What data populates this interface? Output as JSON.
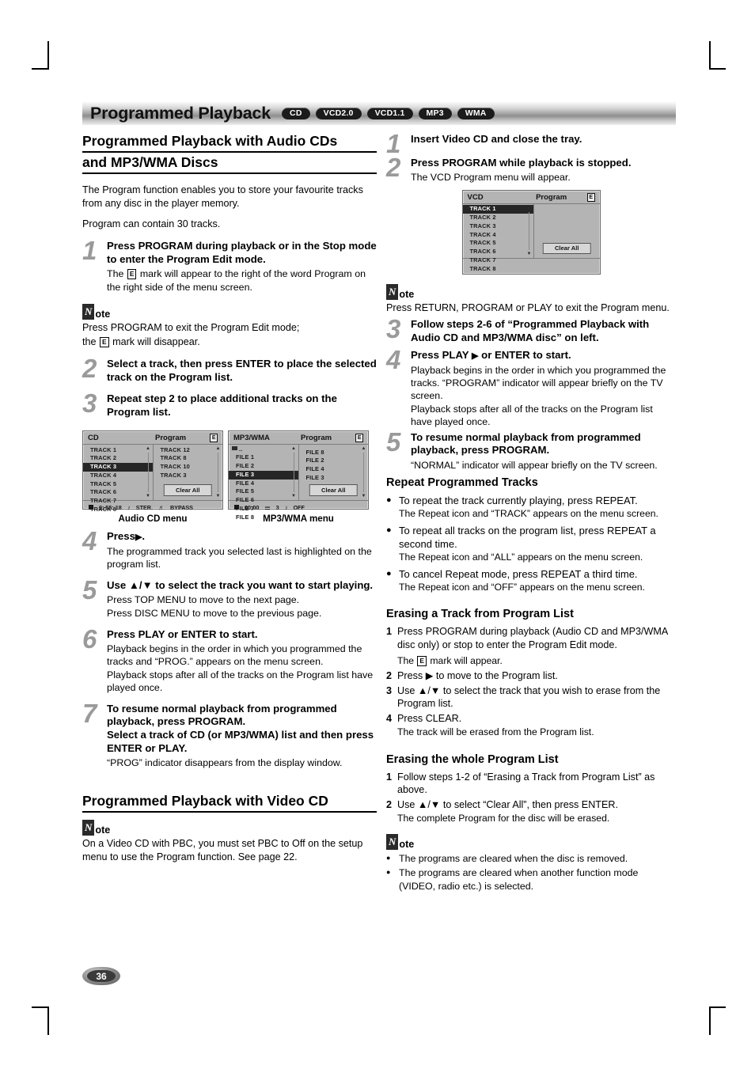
{
  "header": {
    "title": "Programmed Playback",
    "badges": [
      "CD",
      "VCD2.0",
      "VCD1.1",
      "MP3",
      "WMA"
    ]
  },
  "left": {
    "section_title_line1": "Programmed Playback with Audio CDs",
    "section_title_line2": "and MP3/WMA Discs",
    "intro1": "The Program function enables you to store your favourite tracks from any disc in the player memory.",
    "intro2": "Program can contain 30 tracks.",
    "step1": {
      "num": "1",
      "head": "Press PROGRAM during playback or in the Stop mode to enter the Program Edit mode.",
      "sub_a": "The",
      "sub_b": "mark will appear to the right of the word Program on the right side of the menu screen."
    },
    "note1": {
      "badge": "N",
      "word": "ote",
      "line1": "Press PROGRAM to exit the Program Edit mode;",
      "line2_a": "the",
      "line2_b": "mark will disappear."
    },
    "step2": {
      "num": "2",
      "head": "Select a track, then press ENTER to place the selected track on the Program list."
    },
    "step3": {
      "num": "3",
      "head": "Repeat step 2 to place additional tracks on the Program list."
    },
    "cd_screen": {
      "left_title": "CD",
      "right_title": "Program",
      "edit_mark": "E",
      "tracks": [
        "TRACK 1",
        "TRACK 2",
        "TRACK 3",
        "TRACK 4",
        "TRACK 5",
        "TRACK 6",
        "TRACK 7",
        "TRACK 8"
      ],
      "highlight_index": 2,
      "program": [
        "TRACK 12",
        "TRACK 8",
        "TRACK 10",
        "TRACK 3"
      ],
      "clear_all": "Clear All",
      "status_time": "0: 55: 18",
      "status_audio": "STER.",
      "status_mode": "BYPASS"
    },
    "mp3_screen": {
      "left_title": "MP3/WMA",
      "right_title": "Program",
      "edit_mark": "E",
      "folder_row": "..",
      "files": [
        "FILE 1",
        "FILE 2",
        "FILE 3",
        "FILE 4",
        "FILE 5",
        "FILE 6",
        "FILE 7",
        "FILE 8"
      ],
      "highlight_index": 2,
      "program": [
        "FILE 8",
        "FILE 2",
        "FILE 4",
        "FILE 3"
      ],
      "clear_all": "Clear All",
      "status_time": "00:00",
      "status_count": "3",
      "status_mode": "OFF"
    },
    "caption_cd": "Audio CD menu",
    "caption_mp3": "MP3/WMA menu",
    "step4": {
      "num": "4",
      "head": "Press",
      "head_arrow": "▶",
      "head_end": ".",
      "sub": "The programmed track you selected last is highlighted on the program list."
    },
    "step5": {
      "num": "5",
      "head": "Use ▲/▼ to select the track you want to start playing.",
      "sub1": "Press TOP MENU to move to the next page.",
      "sub2": "Press DISC MENU to move to the previous page."
    },
    "step6": {
      "num": "6",
      "head": "Press PLAY or ENTER to start.",
      "sub1": "Playback begins in the order in which you programmed the tracks and “PROG.” appears on the menu screen.",
      "sub2": "Playback stops after all of the tracks on the Program list have played once."
    },
    "step7": {
      "num": "7",
      "head1": "To resume normal playback from programmed playback, press PROGRAM.",
      "head2": "Select a track of CD (or MP3/WMA) list and then press ENTER or PLAY.",
      "sub": "“PROG” indicator disappears from the display window."
    },
    "video_section_title": "Programmed Playback with Video CD",
    "note_video": {
      "badge": "N",
      "word": "ote",
      "text": "On a Video CD with PBC, you must set PBC to Off on the setup menu to use the Program function. See page 22."
    },
    "page_number": "36"
  },
  "right": {
    "step1": {
      "num": "1",
      "head": "Insert Video CD and close the tray."
    },
    "step2": {
      "num": "2",
      "head": "Press PROGRAM while playback is stopped.",
      "sub": "The VCD Program menu will appear."
    },
    "vcd_screen": {
      "left_title": "VCD",
      "right_title": "Program",
      "edit_mark": "E",
      "tracks": [
        "TRACK 1",
        "TRACK 2",
        "TRACK 3",
        "TRACK 4",
        "TRACK 5",
        "TRACK 6",
        "TRACK 7",
        "TRACK 8"
      ],
      "highlight_index": 0,
      "program": [],
      "clear_all": "Clear All"
    },
    "note1": {
      "badge": "N",
      "word": "ote",
      "text": "Press RETURN, PROGRAM or PLAY to exit the Program menu."
    },
    "step3": {
      "num": "3",
      "head": "Follow steps 2-6 of “Programmed Playback with Audio CD and MP3/WMA disc” on left."
    },
    "step4": {
      "num": "4",
      "head_a": "Press PLAY",
      "head_arrow": "▶",
      "head_b": "or ENTER to start.",
      "sub1": "Playback begins in the order in which you programmed the tracks. “PROGRAM” indicator will appear briefly on the TV screen.",
      "sub2": "Playback stops after all of the tracks on the Program list have played once."
    },
    "step5": {
      "num": "5",
      "head": "To resume normal playback from programmed playback, press PROGRAM.",
      "sub": "“NORMAL” indicator will appear briefly on the TV screen."
    },
    "repeat_heading": "Repeat Programmed Tracks",
    "repeat_bullets": [
      {
        "text": "To repeat the track currently playing, press REPEAT.",
        "sub": "The Repeat icon and “TRACK” appears on the menu screen."
      },
      {
        "text": "To repeat all tracks on the program list, press REPEAT a second time.",
        "sub": "The Repeat icon and “ALL” appears on the menu screen."
      },
      {
        "text": "To cancel Repeat mode, press REPEAT a third time.",
        "sub": "The Repeat icon and “OFF” appears on the menu screen."
      }
    ],
    "erase_track_heading": "Erasing a Track from Program List",
    "erase_track_steps": [
      {
        "n": "1",
        "t": "Press PROGRAM during playback (Audio CD and MP3/WMA disc only) or stop to enter the Program Edit mode."
      },
      {
        "n": "2",
        "t": "Press ▶ to move to the Program list."
      },
      {
        "n": "3",
        "t": "Use ▲/▼ to select the track that you wish to erase from the Program list."
      },
      {
        "n": "4",
        "t": "Press CLEAR."
      }
    ],
    "erase_track_sub1_a": "The",
    "erase_track_sub1_b": "mark will appear.",
    "erase_track_sub4": "The track will be erased from the Program list.",
    "erase_all_heading": "Erasing the whole Program List",
    "erase_all_steps": [
      {
        "n": "1",
        "t": "Follow steps 1-2 of “Erasing a Track from Program List” as above."
      },
      {
        "n": "2",
        "t": "Use ▲/▼ to select “Clear All”, then press ENTER."
      }
    ],
    "erase_all_sub2": "The complete Program for the disc will be erased.",
    "note2": {
      "badge": "N",
      "word": "ote",
      "bullets": [
        "The programs are cleared when the disc is removed.",
        "The programs are cleared when another function mode (VIDEO, radio etc.) is selected."
      ]
    }
  }
}
